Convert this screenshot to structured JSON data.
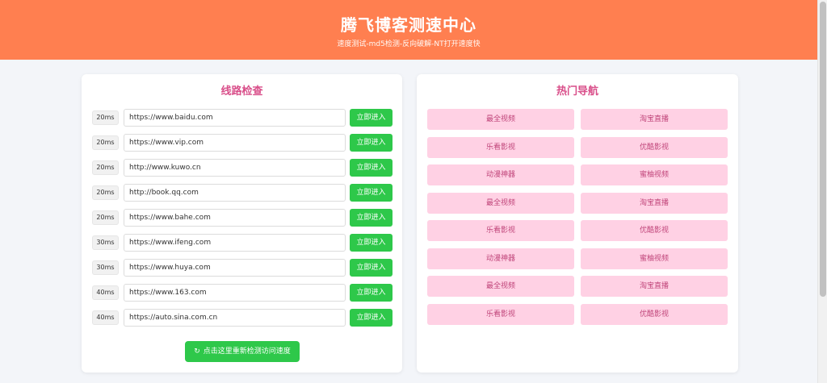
{
  "header": {
    "title": "腾飞博客测速中心",
    "subtitle": "速度测试-md5检测-反向破解-NT打开速度快"
  },
  "colors": {
    "header": "#ff7f50",
    "accent": "#d94f8a",
    "button": "#2ec84a",
    "nav_bg": "#ffd1e4"
  },
  "line_check": {
    "title": "线路检查",
    "enter_label": "立即进入",
    "rows": [
      {
        "ms": "20ms",
        "url": "https://www.baidu.com"
      },
      {
        "ms": "20ms",
        "url": "https://www.vip.com"
      },
      {
        "ms": "20ms",
        "url": "http://www.kuwo.cn"
      },
      {
        "ms": "20ms",
        "url": "http://book.qq.com"
      },
      {
        "ms": "20ms",
        "url": "https://www.bahe.com"
      },
      {
        "ms": "30ms",
        "url": "https://www.ifeng.com"
      },
      {
        "ms": "30ms",
        "url": "https://www.huya.com"
      },
      {
        "ms": "40ms",
        "url": "https://www.163.com"
      },
      {
        "ms": "40ms",
        "url": "https://auto.sina.com.cn"
      }
    ],
    "recheck_label": "点击这里重新检测访问速度",
    "recheck_icon": "refresh-icon"
  },
  "hot_nav": {
    "title": "热门导航",
    "items": [
      "最全视频",
      "淘宝直播",
      "乐看影视",
      "优酷影视",
      "动漫神器",
      "蜜柚视频",
      "最全视频",
      "淘宝直播",
      "乐看影视",
      "优酷影视",
      "动漫神器",
      "蜜柚视频",
      "最全视频",
      "淘宝直播",
      "乐看影视",
      "优酷影视"
    ]
  }
}
